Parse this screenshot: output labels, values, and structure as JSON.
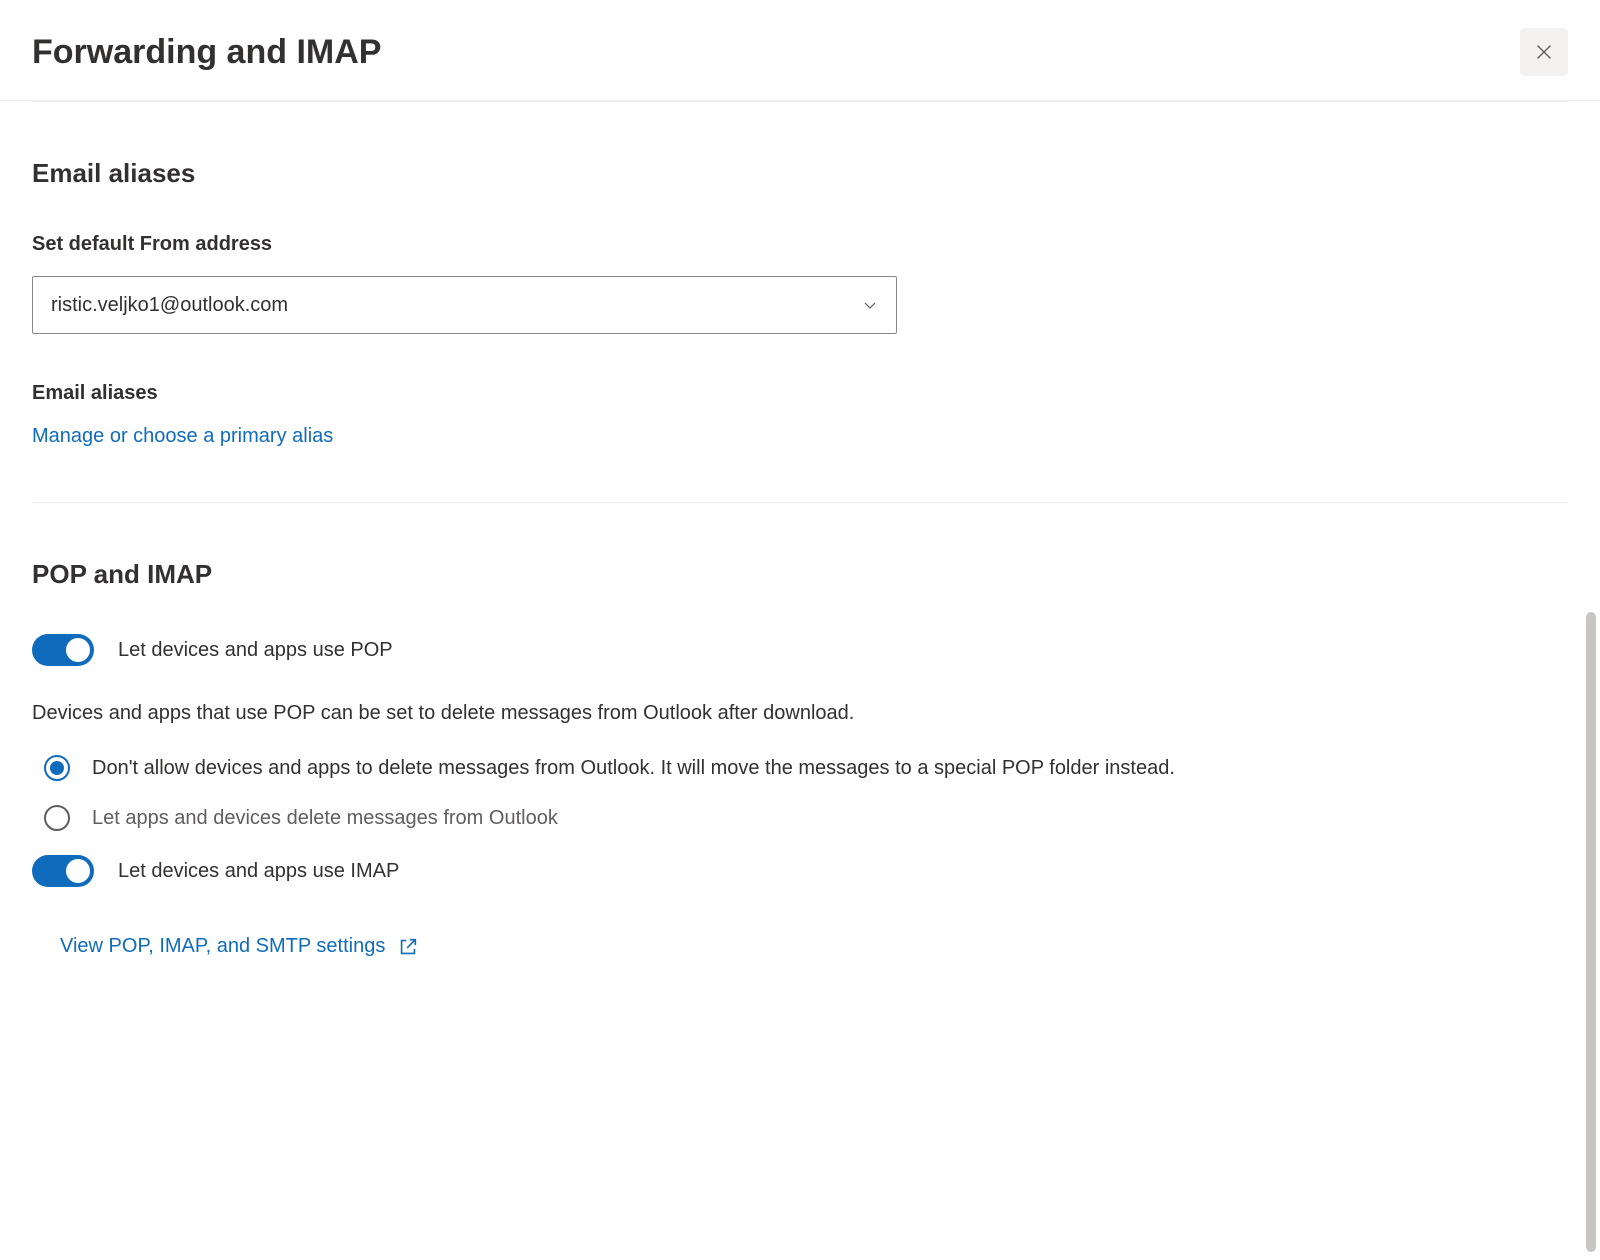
{
  "header": {
    "title": "Forwarding and IMAP"
  },
  "aliases": {
    "title": "Email aliases",
    "default_label": "Set default From address",
    "selected_email": "ristic.veljko1@outlook.com",
    "aliases_label": "Email aliases",
    "manage_link": "Manage or choose a primary alias"
  },
  "pop_imap": {
    "title": "POP and IMAP",
    "pop_toggle_label": "Let devices and apps use POP",
    "description": "Devices and apps that use POP can be set to delete messages from Outlook after download.",
    "radio_dont_allow": "Don't allow devices and apps to delete messages from Outlook. It will move the messages to a special POP folder instead.",
    "radio_allow": "Let apps and devices delete messages from Outlook",
    "imap_toggle_label": "Let devices and apps use IMAP",
    "view_settings_link": "View POP, IMAP, and SMTP settings"
  }
}
